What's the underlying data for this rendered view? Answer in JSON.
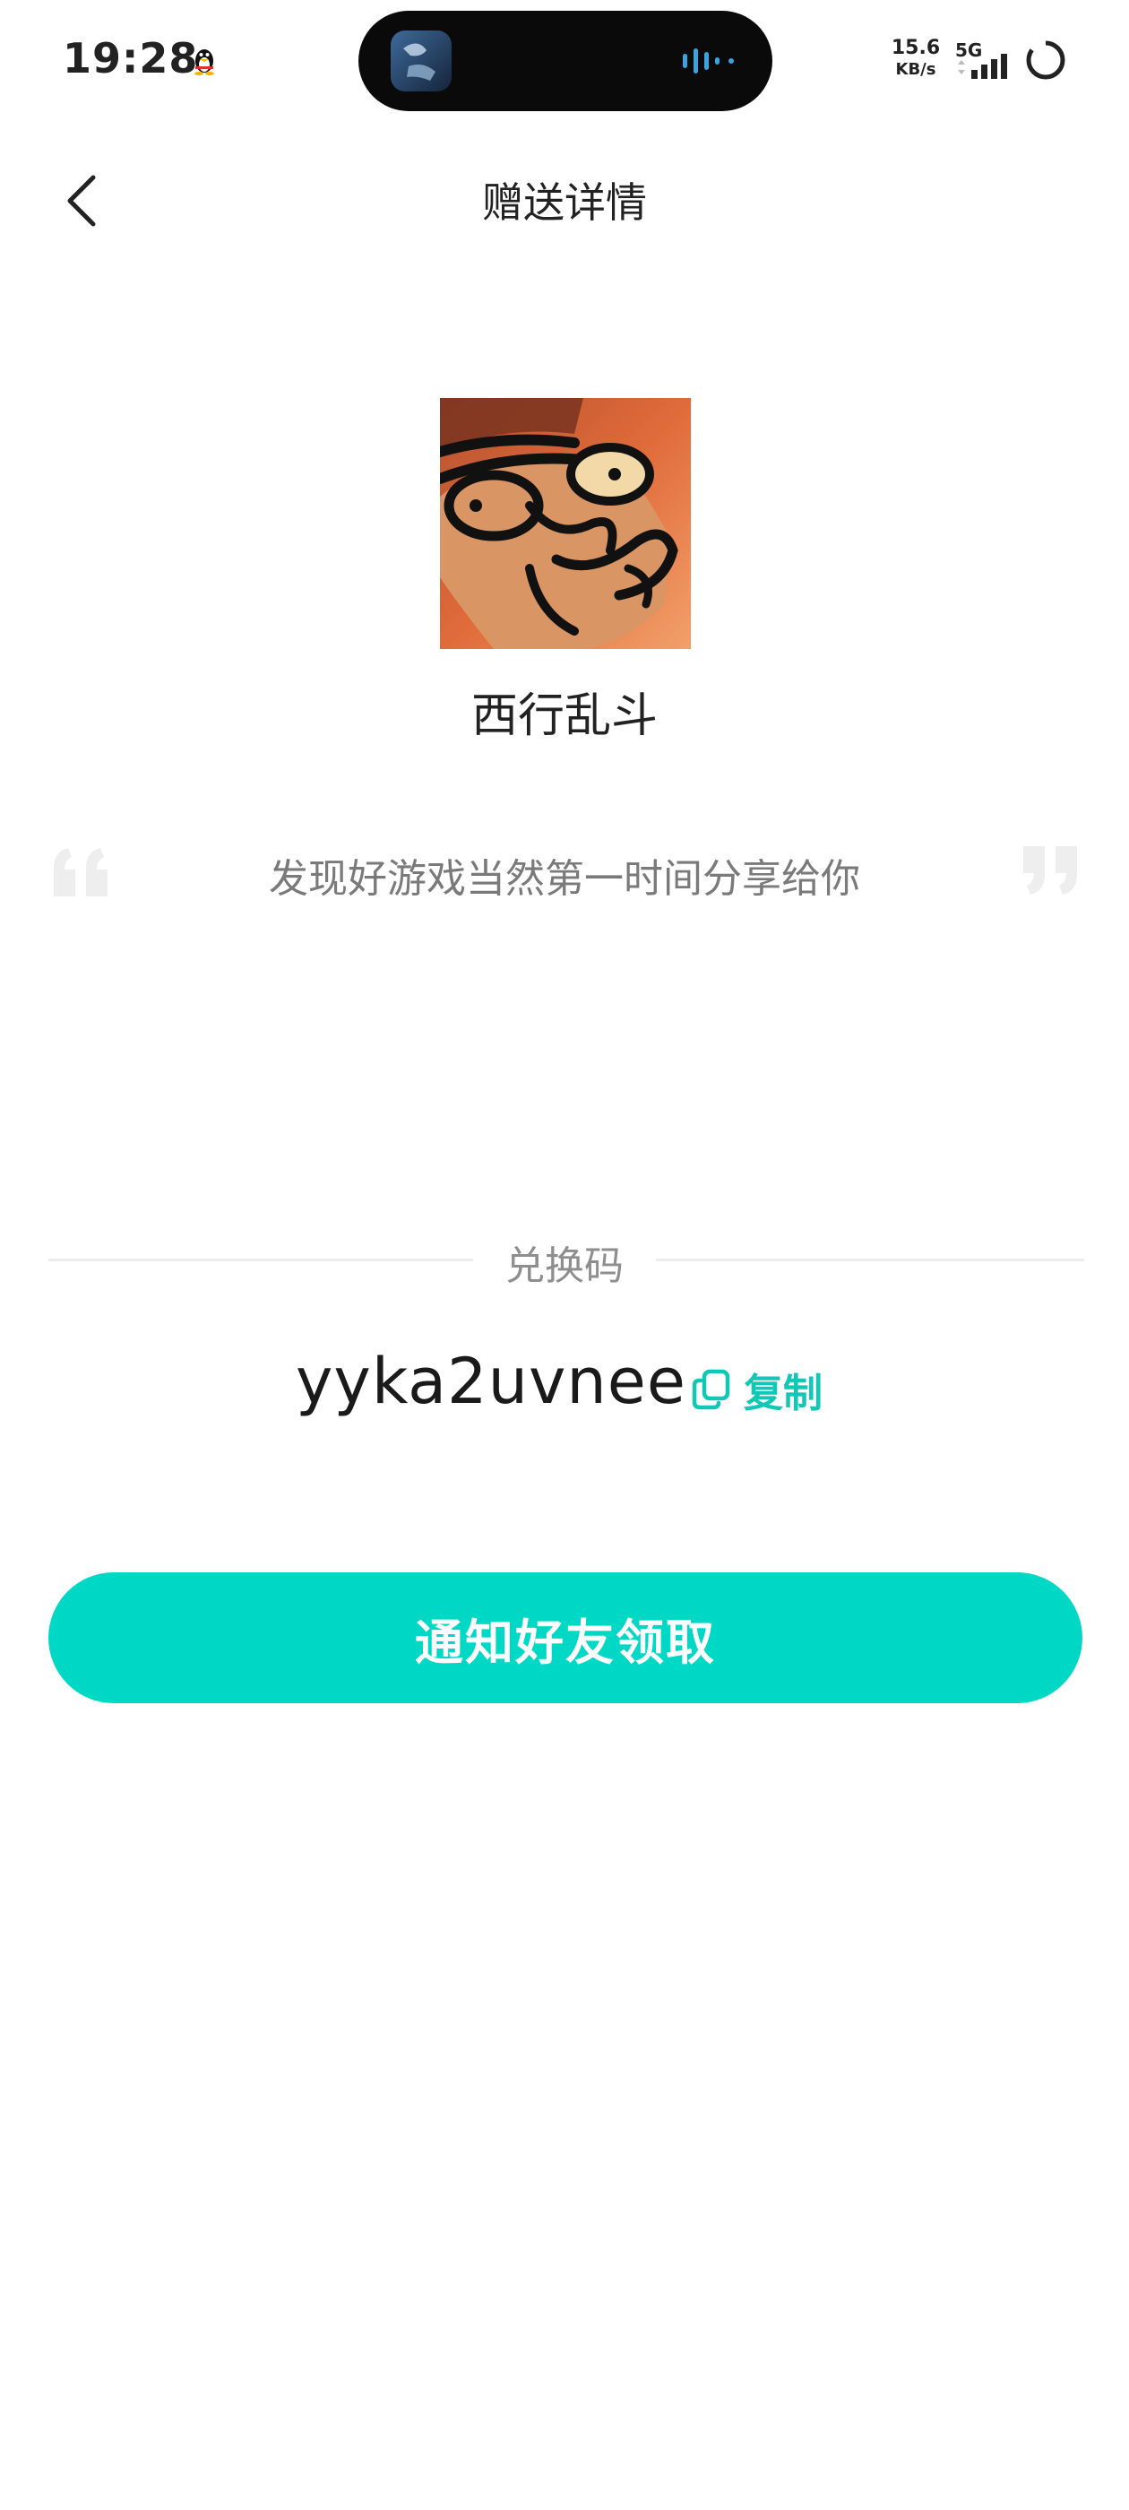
{
  "status_bar": {
    "time": "19:28",
    "net_speed": "15.6",
    "net_speed_unit": "KB/s",
    "network_type": "5G"
  },
  "nav": {
    "title": "赠送详情"
  },
  "game": {
    "name": "西行乱斗"
  },
  "quote": {
    "text": "发现好游戏当然第一时间分享给你"
  },
  "redeem": {
    "label": "兑换码",
    "code": "yyka2uvnee",
    "copy_label": "复制"
  },
  "actions": {
    "notify_label": "通知好友领取"
  },
  "colors": {
    "accent": "#00d8c6",
    "copy_text": "#10c8b4",
    "divider": "#ececec",
    "quote_mark": "#eeeeee"
  },
  "icons": {
    "back": "chevron-left-icon",
    "copy": "copy-icon",
    "quote_open": "quote-open-icon",
    "quote_close": "quote-close-icon"
  }
}
